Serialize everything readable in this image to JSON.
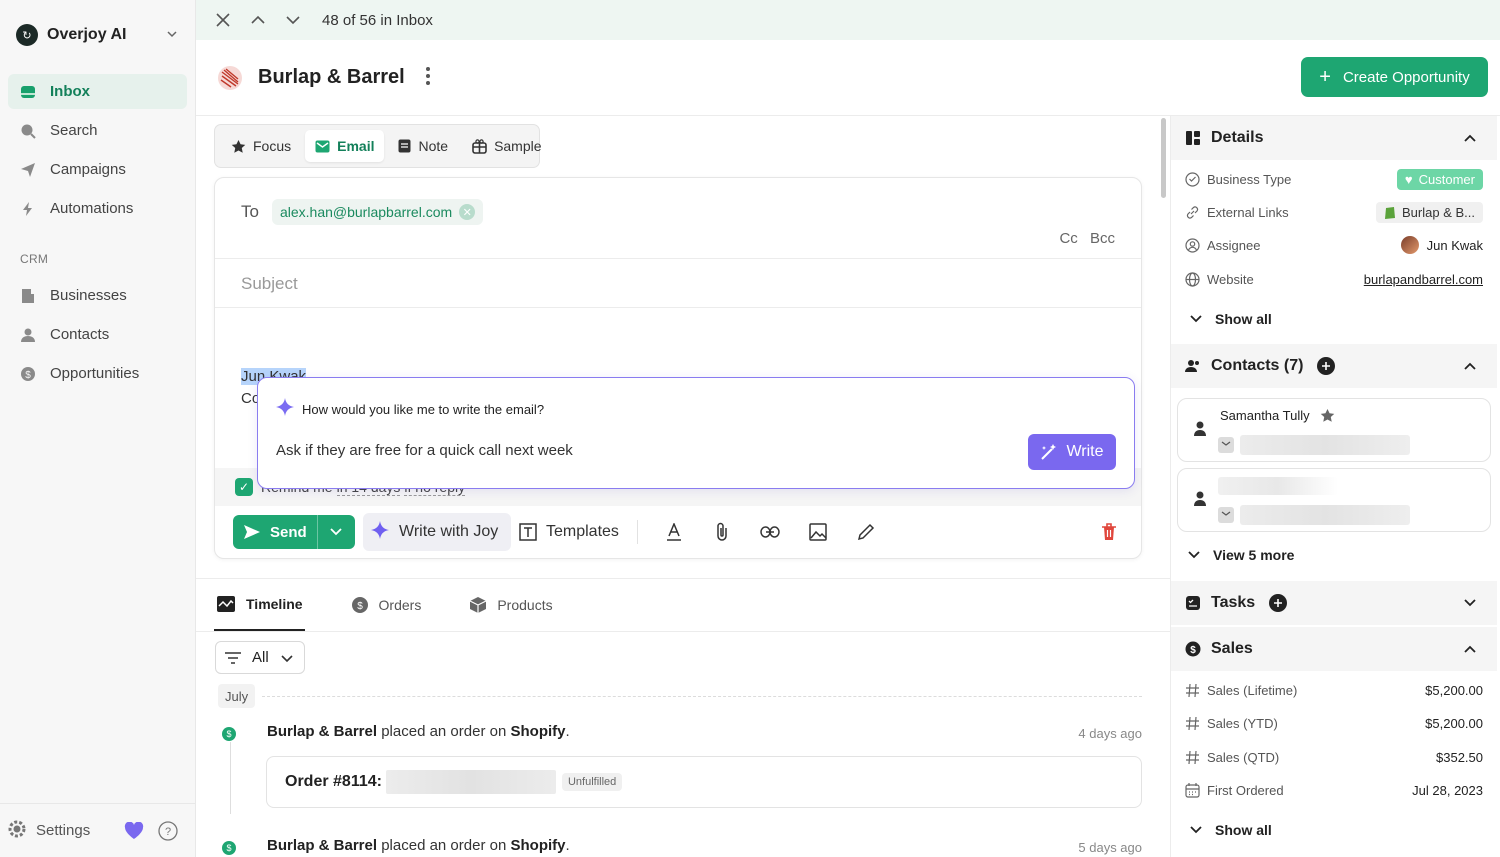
{
  "brand": {
    "name": "Overjoy AI",
    "logo_glyph": "↻"
  },
  "sidebar": {
    "items": [
      {
        "label": "Inbox",
        "icon": "inbox-icon"
      },
      {
        "label": "Search",
        "icon": "search-icon"
      },
      {
        "label": "Campaigns",
        "icon": "send-icon"
      },
      {
        "label": "Automations",
        "icon": "bolt-icon"
      }
    ],
    "crm_label": "CRM",
    "crm_items": [
      {
        "label": "Businesses",
        "icon": "building-icon"
      },
      {
        "label": "Contacts",
        "icon": "person-icon"
      },
      {
        "label": "Opportunities",
        "icon": "dollar-icon"
      }
    ],
    "settings_label": "Settings"
  },
  "topbar": {
    "position_text": "48 of 56 in Inbox"
  },
  "header": {
    "company": "Burlap & Barrel",
    "create_button": "Create Opportunity"
  },
  "mode_tabs": [
    {
      "label": "Focus"
    },
    {
      "label": "Email"
    },
    {
      "label": "Note"
    },
    {
      "label": "Sample"
    }
  ],
  "composer": {
    "to_label": "To",
    "to_email": "alex.han@burlapbarrel.com",
    "cc": "Cc",
    "bcc": "Bcc",
    "subject_placeholder": "Subject",
    "signature_line1": "Jun Kwak",
    "signature_line2": "Co",
    "remind_prefix": "Remind me",
    "remind_when": "in 14 days",
    "remind_cond": "if no reply"
  },
  "ai": {
    "question": "How would you like me to write the email?",
    "prompt": "Ask if they are free for a quick call next week",
    "write_button": "Write"
  },
  "toolbar": {
    "send": "Send",
    "write_with_joy": "Write with Joy",
    "templates": "Templates"
  },
  "timeline_tabs": [
    {
      "label": "Timeline"
    },
    {
      "label": "Orders"
    },
    {
      "label": "Products"
    }
  ],
  "filter": {
    "label": "All"
  },
  "timeline": {
    "month": "July",
    "events": [
      {
        "actor": "Burlap & Barrel",
        "verb": " placed an order on ",
        "platform": "Shopify",
        "end": ".",
        "time": "4 days ago"
      },
      {
        "actor": "Burlap & Barrel",
        "verb": " placed an order on ",
        "platform": "Shopify",
        "end": ".",
        "time": "5 days ago"
      }
    ],
    "order": {
      "id": "Order #8114:",
      "status": "Unfulfilled"
    }
  },
  "details": {
    "title": "Details",
    "rows": [
      {
        "label": "Business Type",
        "value": "Customer"
      },
      {
        "label": "External Links",
        "value": "Burlap & B..."
      },
      {
        "label": "Assignee",
        "value": "Jun Kwak"
      },
      {
        "label": "Website",
        "value": "burlapandbarrel.com"
      }
    ],
    "show_all": "Show all"
  },
  "contacts": {
    "title": "Contacts (7)",
    "first_name": "Samantha Tully",
    "view_more": "View 5 more"
  },
  "tasks": {
    "title": "Tasks"
  },
  "sales": {
    "title": "Sales",
    "rows": [
      {
        "label": "Sales (Lifetime)",
        "value": "$5,200.00"
      },
      {
        "label": "Sales (YTD)",
        "value": "$5,200.00"
      },
      {
        "label": "Sales (QTD)",
        "value": "$352.50"
      },
      {
        "label": "First Ordered",
        "value": "Jul 28, 2023"
      }
    ],
    "show_all": "Show all"
  },
  "colors": {
    "accent": "#1ea672",
    "ai": "#7a68ef",
    "danger": "#e0463c"
  }
}
